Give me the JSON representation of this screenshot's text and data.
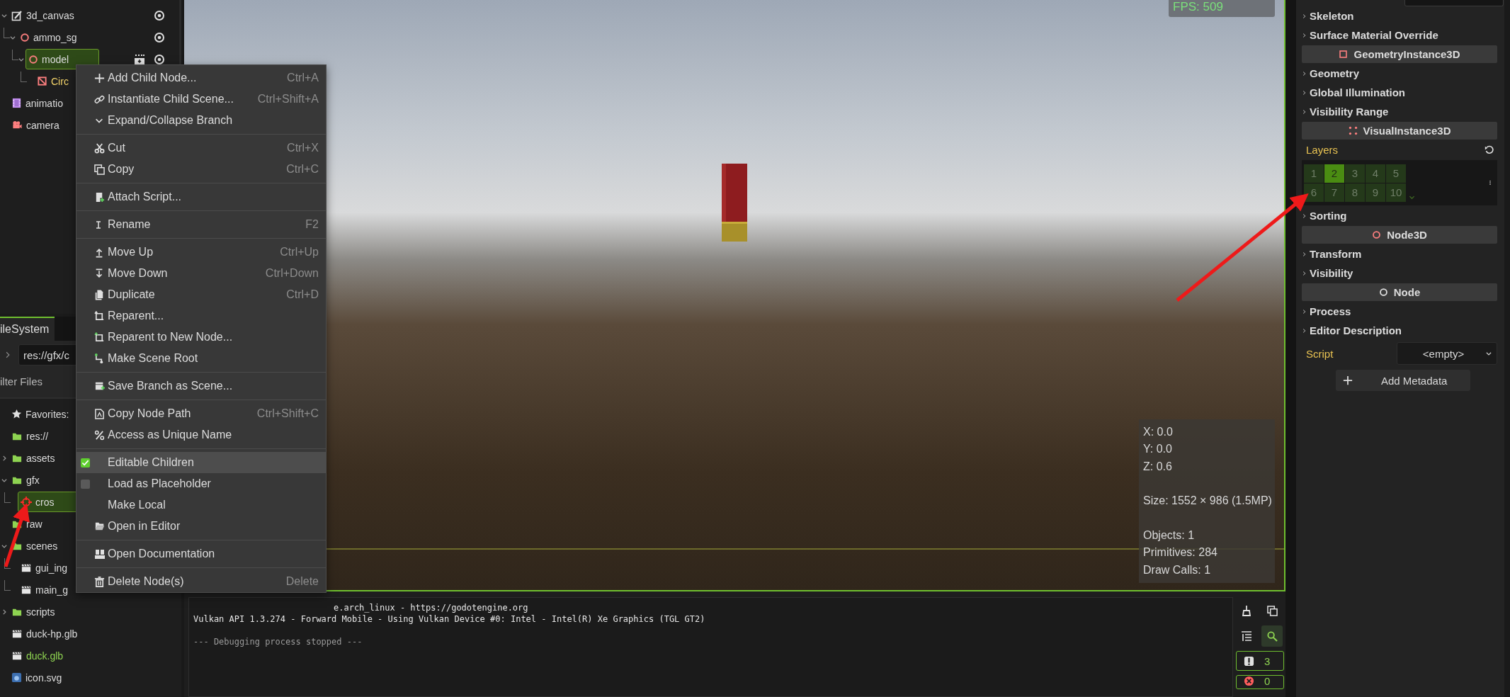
{
  "scene_tree": {
    "items": [
      {
        "name": "3d_canvas",
        "kind": "canvas",
        "expanded": true,
        "selected": false,
        "editable": false,
        "instanced": false,
        "visible": true,
        "children": [
          {
            "name": "ammo_sg",
            "kind": "node3d",
            "expanded": true,
            "selected": false,
            "editable": false,
            "instanced": false,
            "visible": true,
            "children": [
              {
                "name": "model",
                "kind": "node3d",
                "expanded": true,
                "selected": true,
                "editable": false,
                "instanced": true,
                "visible": true,
                "children": [
                  {
                    "name": "Circ",
                    "kind": "mesh",
                    "selected": false,
                    "editable": true
                  }
                ]
              }
            ]
          }
        ]
      },
      {
        "name": "animatio",
        "kind": "animation",
        "selected": false,
        "editable": false
      },
      {
        "name": "camera",
        "kind": "camera",
        "selected": false,
        "editable": false
      }
    ]
  },
  "filesystem": {
    "tab": {
      "label": "ileSystem",
      "selected": true
    },
    "path": {
      "value": "res://gfx/c"
    },
    "filter": {
      "placeholder": "ilter Files"
    },
    "items": [
      {
        "name": "Favorites:",
        "kind": "favorites",
        "selected": false,
        "highlighted": false
      },
      {
        "name": "res://",
        "kind": "folder",
        "selected": false,
        "highlighted": false,
        "children": [
          {
            "name": "assets",
            "kind": "folder",
            "expanded": false,
            "selected": false,
            "highlighted": false
          },
          {
            "name": "gfx",
            "kind": "folder",
            "expanded": true,
            "selected": false,
            "highlighted": false,
            "children": [
              {
                "name": "cros",
                "kind": "crosshair",
                "selected": true,
                "highlighted": false
              }
            ]
          },
          {
            "name": "raw",
            "kind": "folder",
            "selected": false,
            "highlighted": false
          },
          {
            "name": "scenes",
            "kind": "folder",
            "expanded": true,
            "selected": false,
            "highlighted": false,
            "children": [
              {
                "name": "gui_ing",
                "kind": "scene",
                "selected": false,
                "highlighted": false
              },
              {
                "name": "main_g",
                "kind": "scene",
                "selected": false,
                "highlighted": false
              }
            ]
          },
          {
            "name": "scripts",
            "kind": "folder",
            "expanded": false,
            "selected": false,
            "highlighted": false
          },
          {
            "name": "duck-hp.glb",
            "kind": "scene",
            "selected": false,
            "highlighted": false
          },
          {
            "name": "duck.glb",
            "kind": "scene",
            "selected": false,
            "highlighted": true
          },
          {
            "name": "icon.svg",
            "kind": "image",
            "selected": false,
            "highlighted": false
          }
        ]
      }
    ]
  },
  "context_menu": {
    "groups": [
      [
        {
          "label": "Add Child Node...",
          "shortcut": "Ctrl+A",
          "kind": "command",
          "selected": false
        },
        {
          "label": "Instantiate Child Scene...",
          "shortcut": "Ctrl+Shift+A",
          "kind": "command",
          "selected": false
        },
        {
          "label": "Expand/Collapse Branch",
          "kind": "command",
          "selected": false
        }
      ],
      [
        {
          "label": "Cut",
          "shortcut": "Ctrl+X",
          "kind": "command",
          "selected": false
        },
        {
          "label": "Copy",
          "shortcut": "Ctrl+C",
          "kind": "command",
          "selected": false
        }
      ],
      [
        {
          "label": "Attach Script...",
          "kind": "command",
          "selected": false
        }
      ],
      [
        {
          "label": "Rename",
          "shortcut": "F2",
          "kind": "command",
          "selected": false
        }
      ],
      [
        {
          "label": "Move Up",
          "shortcut": "Ctrl+Up",
          "kind": "command",
          "selected": false
        },
        {
          "label": "Move Down",
          "shortcut": "Ctrl+Down",
          "kind": "command",
          "selected": false
        },
        {
          "label": "Duplicate",
          "shortcut": "Ctrl+D",
          "kind": "command",
          "selected": false
        },
        {
          "label": "Reparent...",
          "kind": "command",
          "selected": false
        },
        {
          "label": "Reparent to New Node...",
          "kind": "command",
          "selected": false
        },
        {
          "label": "Make Scene Root",
          "kind": "command",
          "selected": false
        }
      ],
      [
        {
          "label": "Save Branch as Scene...",
          "kind": "command",
          "selected": false
        }
      ],
      [
        {
          "label": "Copy Node Path",
          "shortcut": "Ctrl+Shift+C",
          "kind": "command",
          "selected": false
        },
        {
          "label": "Access as Unique Name",
          "kind": "command",
          "selected": false
        }
      ],
      [
        {
          "label": "Editable Children",
          "kind": "check",
          "checked": true,
          "selected": true
        },
        {
          "label": "Load as Placeholder",
          "kind": "check",
          "checked": false,
          "selected": false
        },
        {
          "label": "Make Local",
          "kind": "command",
          "selected": false
        },
        {
          "label": "Open in Editor",
          "kind": "command",
          "selected": false
        }
      ],
      [
        {
          "label": "Open Documentation",
          "kind": "command",
          "selected": false
        }
      ],
      [
        {
          "label": "Delete Node(s)",
          "shortcut": "Delete",
          "kind": "command",
          "selected": false
        }
      ]
    ]
  },
  "viewport": {
    "fps": "FPS: 509",
    "stats": [
      [
        "X: 0.0",
        "Y: 0.0",
        "Z: 0.6"
      ],
      [
        "Size: 1552 × 986 (1.5MP)"
      ],
      [
        "Objects: 1",
        "Primitives: 284",
        "Draw Calls: 1"
      ]
    ]
  },
  "output": {
    "lines": [
      {
        "text": "e.arch_linux - https://godotengine.org",
        "kind": "info"
      },
      {
        "text": "Vulkan API 1.3.274 - Forward Mobile - Using Vulkan Device #0: Intel - Intel(R) Xe Graphics (TGL GT2)",
        "kind": "info"
      },
      {
        "text": "--- Debugging process stopped ---",
        "kind": "muted"
      }
    ],
    "search_toggle": {
      "on": true
    },
    "warnings": "3",
    "errors": "0"
  },
  "inspector": {
    "sections": [
      {
        "kind": "group",
        "label": "Skeleton"
      },
      {
        "kind": "group",
        "label": "Surface Material Override"
      },
      {
        "kind": "class-geometry",
        "label": "GeometryInstance3D"
      },
      {
        "kind": "group",
        "label": "Geometry"
      },
      {
        "kind": "group",
        "label": "Global Illumination"
      },
      {
        "kind": "group",
        "label": "Visibility Range"
      },
      {
        "kind": "class-visual",
        "label": "VisualInstance3D"
      },
      {
        "kind": "layers",
        "label": "Layers",
        "layers": [
          {
            "label": "1",
            "selected": false
          },
          {
            "label": "2",
            "selected": true
          },
          {
            "label": "3",
            "selected": false
          },
          {
            "label": "4",
            "selected": false
          },
          {
            "label": "5",
            "selected": false
          },
          {
            "label": "6",
            "selected": false
          },
          {
            "label": "7",
            "selected": false
          },
          {
            "label": "8",
            "selected": false
          },
          {
            "label": "9",
            "selected": false
          },
          {
            "label": "10",
            "selected": false
          }
        ]
      },
      {
        "kind": "group",
        "label": "Sorting"
      },
      {
        "kind": "class-node3d",
        "label": "Node3D"
      },
      {
        "kind": "group",
        "label": "Transform"
      },
      {
        "kind": "group",
        "label": "Visibility"
      },
      {
        "kind": "class-node",
        "label": "Node"
      },
      {
        "kind": "group",
        "label": "Process"
      },
      {
        "kind": "group",
        "label": "Editor Description"
      }
    ],
    "script": {
      "label": "Script",
      "value": "<empty>"
    },
    "add_metadata": "Add Metadata"
  }
}
